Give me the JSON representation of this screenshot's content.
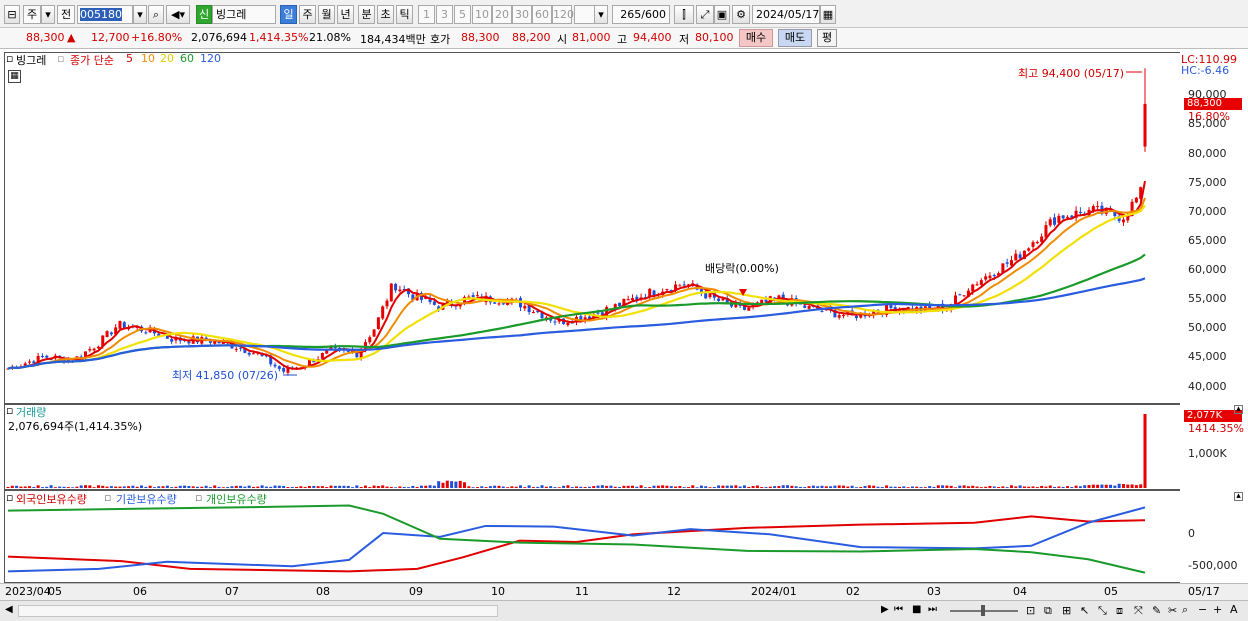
{
  "toolbar": {
    "market": "주",
    "jeon": "전",
    "code": "005180",
    "category": "신",
    "stock_name": "빙그레",
    "periods": [
      "일",
      "주",
      "월",
      "년",
      "분",
      "초",
      "틱"
    ],
    "intervals": [
      "1",
      "3",
      "5",
      "10",
      "20",
      "30",
      "60",
      "120"
    ],
    "count": "265",
    "count_total": "/600",
    "date": "2024/05/17"
  },
  "info": {
    "price": "88,300",
    "arrow": "▲",
    "change": "12,700",
    "pct": "+16.80%",
    "volume": "2,076,694",
    "vol_pct": "1,414.35%",
    "turnover": "21.08%",
    "amount": "184,434백만",
    "quote_label": "호가",
    "quote_ask": "88,300",
    "quote_bid": "88,200",
    "open_label": "시",
    "open": "81,000",
    "high_label": "고",
    "high": "94,400",
    "low_label": "저",
    "low": "80,100",
    "buy": "매수",
    "sell": "매도",
    "avg": "평"
  },
  "main": {
    "stock": "빙그레",
    "ma_label": "종가 단순",
    "ma_periods": [
      "5",
      "10",
      "20",
      "60",
      "120"
    ],
    "lc": "LC:110.99",
    "hc": "HC:-6.46",
    "high_note": "최고 94,400 (05/17)",
    "low_note": "최저 41,850 (07/26)",
    "dividend": "배당락(0.00%)",
    "price_tag": "88,300",
    "pct_tag": "16.80%",
    "ticks": [
      "90,000",
      "85,000",
      "80,000",
      "75,000",
      "70,000",
      "65,000",
      "60,000",
      "55,000",
      "50,000",
      "45,000",
      "40,000"
    ]
  },
  "volume": {
    "title": "거래량",
    "value": "2,076,694주(1,414.35%)",
    "tag": "2,077K",
    "tag_pct": "1414.35%",
    "tick": "1,000K"
  },
  "holdings": {
    "foreign": "외국인보유수량",
    "institution": "기관보유수량",
    "individual": "개인보유수량",
    "ticks": [
      "0",
      "-500,000"
    ]
  },
  "xaxis": [
    "2023/04",
    "05",
    "06",
    "07",
    "08",
    "09",
    "10",
    "11",
    "12",
    "2024/01",
    "02",
    "03",
    "04",
    "05"
  ],
  "xaxis_right": "05/17",
  "colors": {
    "up": "#e60000",
    "down": "#1f4fd6",
    "ma5": "#e00000",
    "ma10": "#f08c00",
    "ma20": "#f2e000",
    "ma60": "#1a9a2a",
    "ma120": "#2a5ce0"
  }
}
